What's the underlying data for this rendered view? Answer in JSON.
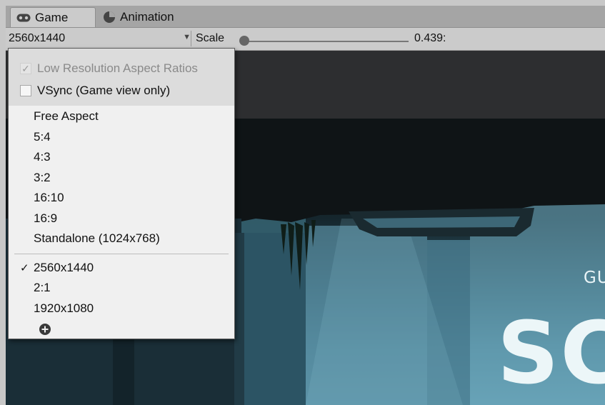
{
  "tabs": [
    {
      "label": "Game",
      "icon": "gamepad-icon",
      "active": true
    },
    {
      "label": "Animation",
      "icon": "clock-icon",
      "active": false
    }
  ],
  "toolbar": {
    "resolution_value": "2560x1440",
    "scale_label": "Scale",
    "scale_value": "0.439:",
    "scale_slider_fraction": 0.0
  },
  "dropdown": {
    "toggles": [
      {
        "label": "Low Resolution Aspect Ratios",
        "checked": true,
        "disabled": true
      },
      {
        "label": "VSync (Game view only)",
        "checked": false,
        "disabled": false
      }
    ],
    "aspect_items": [
      "Free Aspect",
      "5:4",
      "4:3",
      "3:2",
      "16:10",
      "16:9",
      "Standalone (1024x768)"
    ],
    "custom_items": [
      {
        "label": "2560x1440",
        "selected": true
      },
      {
        "label": "2:1",
        "selected": false
      },
      {
        "label": "1920x1080",
        "selected": false
      }
    ],
    "check_glyph": "✓",
    "add_icon": "add-circle-icon"
  },
  "game_view": {
    "title_small": "GU",
    "title_big": "SC"
  },
  "colors": {
    "tab_bar": "#a5a5a5",
    "toolbar": "#cbcbcb",
    "dropdown_bg": "#f0f0f0",
    "scene_sky": "#5e9aaf"
  }
}
